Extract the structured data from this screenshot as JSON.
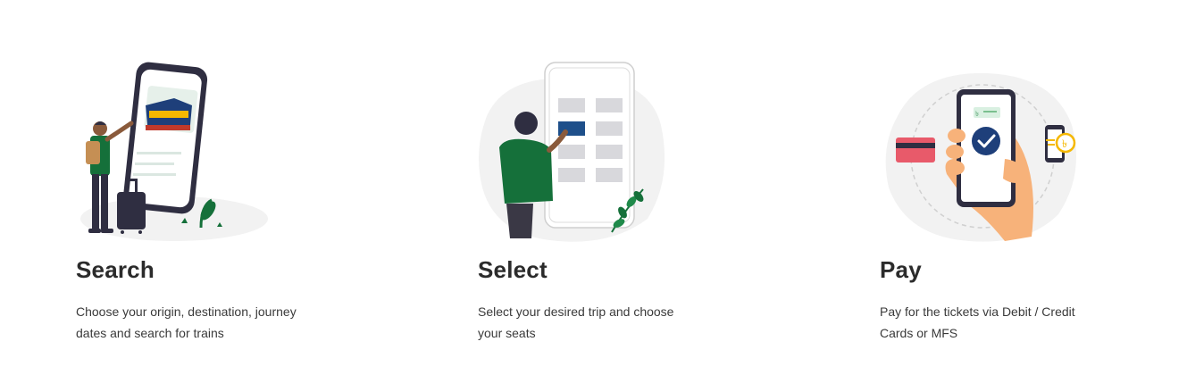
{
  "steps": [
    {
      "title": "Search",
      "description": "Choose your origin, destination, journey dates and search for trains",
      "illustration": "person-searching-train-on-phone"
    },
    {
      "title": "Select",
      "description": "Select your desired trip and choose your seats",
      "illustration": "person-selecting-seat-on-phone"
    },
    {
      "title": "Pay",
      "description": "Pay for the tickets via Debit / Credit Cards or MFS",
      "illustration": "hand-paying-with-phone"
    }
  ],
  "colors": {
    "green": "#15703a",
    "navy": "#2f2e41",
    "blob": "#f2f2f2",
    "accent_blue": "#1e4f8a",
    "card_red": "#e85a6a",
    "coin_yellow": "#f5b800",
    "skin": "#f7b27a"
  }
}
